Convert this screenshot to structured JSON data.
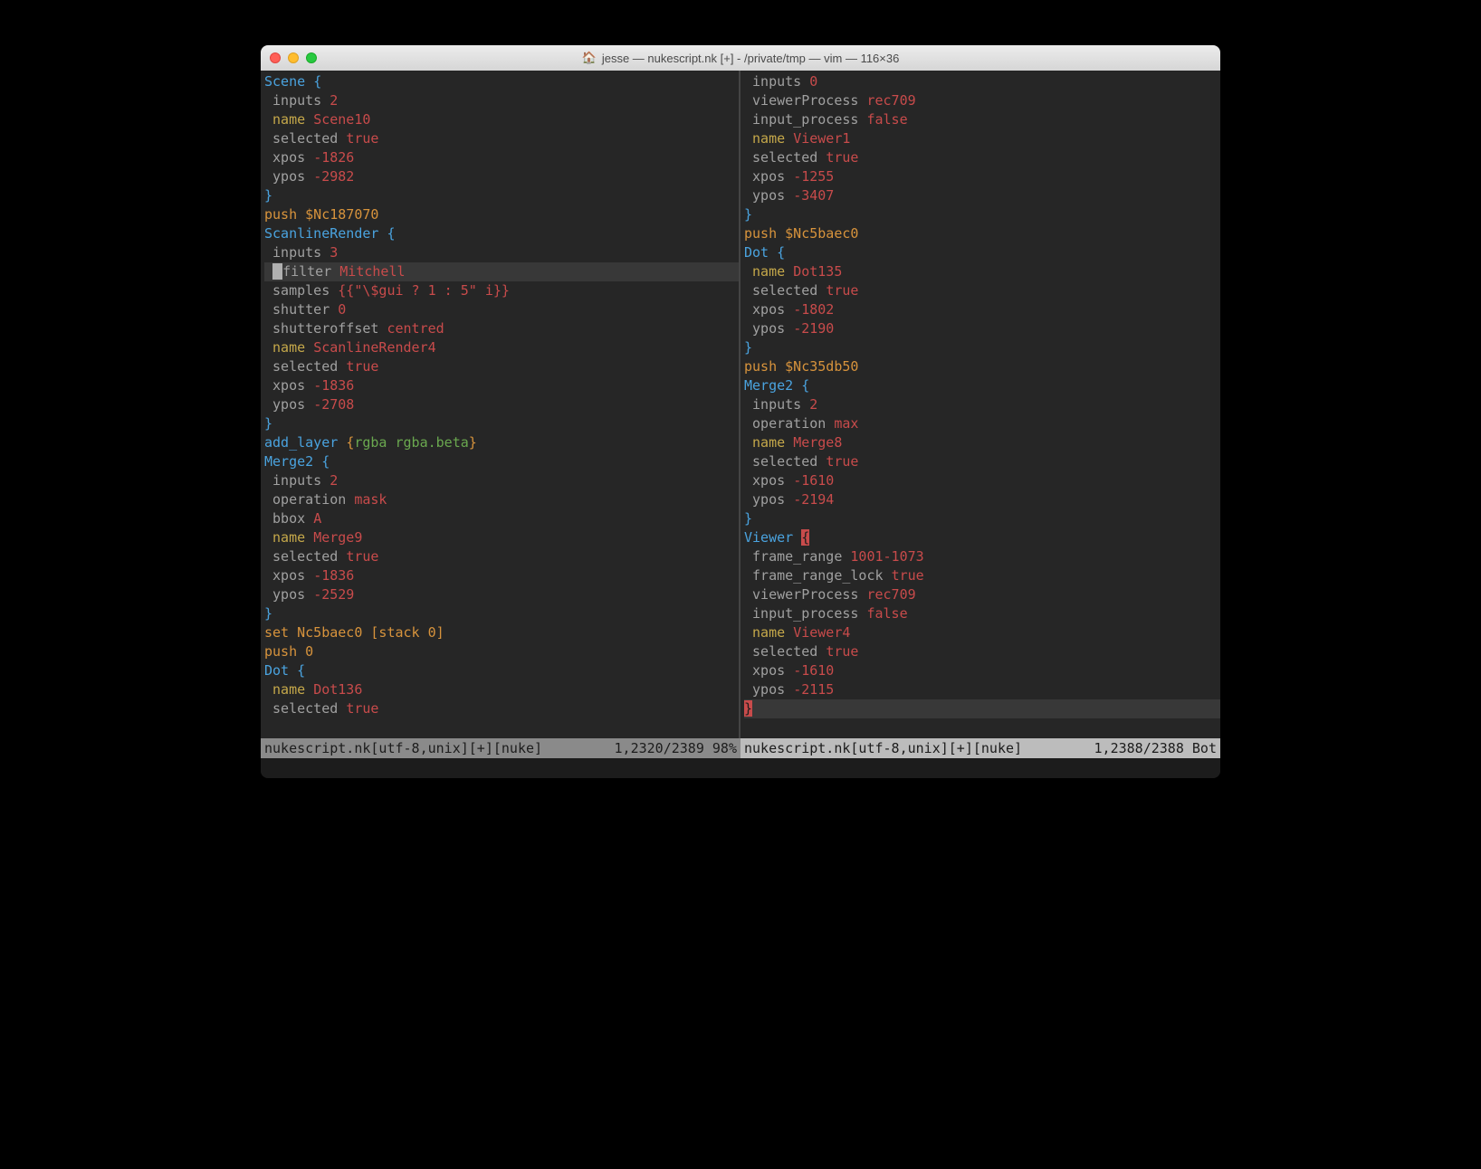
{
  "title": "jesse — nukescript.nk [+] - /private/tmp — vim — 116×36",
  "colors": {
    "bg": "#262626",
    "blue": "#4aa3df",
    "orange": "#d7933c",
    "yellow": "#c5a84a",
    "red": "#c84b4b",
    "green": "#6aa84f",
    "gray": "#a0a0a0",
    "status_inactive": "#8a8a8a",
    "status_active": "#bcbcbc",
    "cursorline": "#383838"
  },
  "left": {
    "status_left": "nukescript.nk[utf-8,unix][+][nuke]",
    "status_right": "1,2320/2389 98%",
    "lines": [
      [
        [
          "blue",
          "Scene"
        ],
        [
          "gray",
          " "
        ],
        [
          "blue",
          "{"
        ]
      ],
      [
        [
          "ind"
        ],
        [
          "gray",
          "inputs "
        ],
        [
          "red",
          "2"
        ]
      ],
      [
        [
          "ind"
        ],
        [
          "yellow",
          "name "
        ],
        [
          "red",
          "Scene10"
        ]
      ],
      [
        [
          "ind"
        ],
        [
          "gray",
          "selected "
        ],
        [
          "red",
          "true"
        ]
      ],
      [
        [
          "ind"
        ],
        [
          "gray",
          "xpos "
        ],
        [
          "red",
          "-1826"
        ]
      ],
      [
        [
          "ind"
        ],
        [
          "gray",
          "ypos "
        ],
        [
          "red",
          "-2982"
        ]
      ],
      [
        [
          "blue",
          "}"
        ]
      ],
      [
        [
          "orange",
          "push $Nc187070"
        ]
      ],
      [
        [
          "blue",
          "ScanlineRender"
        ],
        [
          "gray",
          " "
        ],
        [
          "blue",
          "{"
        ]
      ],
      [
        [
          "ind"
        ],
        [
          "gray",
          "inputs "
        ],
        [
          "red",
          "3"
        ]
      ],
      [
        [
          "cursorline"
        ],
        [
          "ind"
        ],
        [
          "cursorblock",
          " "
        ],
        [
          "gray",
          "filter "
        ],
        [
          "red",
          "Mitchell"
        ]
      ],
      [
        [
          "ind"
        ],
        [
          "gray",
          "samples "
        ],
        [
          "red",
          "{{\"\\$gui ? 1 : 5\" i}}"
        ]
      ],
      [
        [
          "ind"
        ],
        [
          "gray",
          "shutter "
        ],
        [
          "red",
          "0"
        ]
      ],
      [
        [
          "ind"
        ],
        [
          "gray",
          "shutteroffset "
        ],
        [
          "red",
          "centred"
        ]
      ],
      [
        [
          "ind"
        ],
        [
          "yellow",
          "name "
        ],
        [
          "red",
          "ScanlineRender4"
        ]
      ],
      [
        [
          "ind"
        ],
        [
          "gray",
          "selected "
        ],
        [
          "red",
          "true"
        ]
      ],
      [
        [
          "ind"
        ],
        [
          "gray",
          "xpos "
        ],
        [
          "red",
          "-1836"
        ]
      ],
      [
        [
          "ind"
        ],
        [
          "gray",
          "ypos "
        ],
        [
          "red",
          "-2708"
        ]
      ],
      [
        [
          "blue",
          "}"
        ]
      ],
      [
        [
          "blue",
          "add_layer "
        ],
        [
          "orange",
          "{"
        ],
        [
          "green",
          "rgba rgba.beta"
        ],
        [
          "orange",
          "}"
        ]
      ],
      [
        [
          "blue",
          "Merge2"
        ],
        [
          "gray",
          " "
        ],
        [
          "blue",
          "{"
        ]
      ],
      [
        [
          "ind"
        ],
        [
          "gray",
          "inputs "
        ],
        [
          "red",
          "2"
        ]
      ],
      [
        [
          "ind"
        ],
        [
          "gray",
          "operation "
        ],
        [
          "red",
          "mask"
        ]
      ],
      [
        [
          "ind"
        ],
        [
          "gray",
          "bbox "
        ],
        [
          "red",
          "A"
        ]
      ],
      [
        [
          "ind"
        ],
        [
          "yellow",
          "name "
        ],
        [
          "red",
          "Merge9"
        ]
      ],
      [
        [
          "ind"
        ],
        [
          "gray",
          "selected "
        ],
        [
          "red",
          "true"
        ]
      ],
      [
        [
          "ind"
        ],
        [
          "gray",
          "xpos "
        ],
        [
          "red",
          "-1836"
        ]
      ],
      [
        [
          "ind"
        ],
        [
          "gray",
          "ypos "
        ],
        [
          "red",
          "-2529"
        ]
      ],
      [
        [
          "blue",
          "}"
        ]
      ],
      [
        [
          "orange",
          "set Nc5baec0 [stack 0]"
        ]
      ],
      [
        [
          "orange",
          "push 0"
        ]
      ],
      [
        [
          "blue",
          "Dot"
        ],
        [
          "gray",
          " "
        ],
        [
          "blue",
          "{"
        ]
      ],
      [
        [
          "ind"
        ],
        [
          "yellow",
          "name "
        ],
        [
          "red",
          "Dot136"
        ]
      ],
      [
        [
          "ind"
        ],
        [
          "gray",
          "selected "
        ],
        [
          "red",
          "true"
        ]
      ]
    ]
  },
  "right": {
    "status_left": "nukescript.nk[utf-8,unix][+][nuke]",
    "status_right": "1,2388/2388 Bot",
    "lines": [
      [
        [
          "ind"
        ],
        [
          "gray",
          "inputs "
        ],
        [
          "red",
          "0"
        ]
      ],
      [
        [
          "ind"
        ],
        [
          "gray",
          "viewerProcess "
        ],
        [
          "red",
          "rec709"
        ]
      ],
      [
        [
          "ind"
        ],
        [
          "gray",
          "input_process "
        ],
        [
          "red",
          "false"
        ]
      ],
      [
        [
          "ind"
        ],
        [
          "yellow",
          "name "
        ],
        [
          "red",
          "Viewer1"
        ]
      ],
      [
        [
          "ind"
        ],
        [
          "gray",
          "selected "
        ],
        [
          "red",
          "true"
        ]
      ],
      [
        [
          "ind"
        ],
        [
          "gray",
          "xpos "
        ],
        [
          "red",
          "-1255"
        ]
      ],
      [
        [
          "ind"
        ],
        [
          "gray",
          "ypos "
        ],
        [
          "red",
          "-3407"
        ]
      ],
      [
        [
          "blue",
          "}"
        ]
      ],
      [
        [
          "orange",
          "push $Nc5baec0"
        ]
      ],
      [
        [
          "blue",
          "Dot"
        ],
        [
          "gray",
          " "
        ],
        [
          "blue",
          "{"
        ]
      ],
      [
        [
          "ind"
        ],
        [
          "yellow",
          "name "
        ],
        [
          "red",
          "Dot135"
        ]
      ],
      [
        [
          "ind"
        ],
        [
          "gray",
          "selected "
        ],
        [
          "red",
          "true"
        ]
      ],
      [
        [
          "ind"
        ],
        [
          "gray",
          "xpos "
        ],
        [
          "red",
          "-1802"
        ]
      ],
      [
        [
          "ind"
        ],
        [
          "gray",
          "ypos "
        ],
        [
          "red",
          "-2190"
        ]
      ],
      [
        [
          "blue",
          "}"
        ]
      ],
      [
        [
          "orange",
          "push $Nc35db50"
        ]
      ],
      [
        [
          "blue",
          "Merge2"
        ],
        [
          "gray",
          " "
        ],
        [
          "blue",
          "{"
        ]
      ],
      [
        [
          "ind"
        ],
        [
          "gray",
          "inputs "
        ],
        [
          "red",
          "2"
        ]
      ],
      [
        [
          "ind"
        ],
        [
          "gray",
          "operation "
        ],
        [
          "red",
          "max"
        ]
      ],
      [
        [
          "ind"
        ],
        [
          "yellow",
          "name "
        ],
        [
          "red",
          "Merge8"
        ]
      ],
      [
        [
          "ind"
        ],
        [
          "gray",
          "selected "
        ],
        [
          "red",
          "true"
        ]
      ],
      [
        [
          "ind"
        ],
        [
          "gray",
          "xpos "
        ],
        [
          "red",
          "-1610"
        ]
      ],
      [
        [
          "ind"
        ],
        [
          "gray",
          "ypos "
        ],
        [
          "red",
          "-2194"
        ]
      ],
      [
        [
          "blue",
          "}"
        ]
      ],
      [
        [
          "blue",
          "Viewer"
        ],
        [
          "gray",
          " "
        ],
        [
          "cursorredblock",
          "{"
        ]
      ],
      [
        [
          "ind"
        ],
        [
          "gray",
          "frame_range "
        ],
        [
          "red",
          "1001-1073"
        ]
      ],
      [
        [
          "ind"
        ],
        [
          "gray",
          "frame_range_lock "
        ],
        [
          "red",
          "true"
        ]
      ],
      [
        [
          "ind"
        ],
        [
          "gray",
          "viewerProcess "
        ],
        [
          "red",
          "rec709"
        ]
      ],
      [
        [
          "ind"
        ],
        [
          "gray",
          "input_process "
        ],
        [
          "red",
          "false"
        ]
      ],
      [
        [
          "ind"
        ],
        [
          "yellow",
          "name "
        ],
        [
          "red",
          "Viewer4"
        ]
      ],
      [
        [
          "ind"
        ],
        [
          "gray",
          "selected "
        ],
        [
          "red",
          "true"
        ]
      ],
      [
        [
          "ind"
        ],
        [
          "gray",
          "xpos "
        ],
        [
          "red",
          "-1610"
        ]
      ],
      [
        [
          "ind"
        ],
        [
          "gray",
          "ypos "
        ],
        [
          "red",
          "-2115"
        ]
      ],
      [
        [
          "cursorline"
        ],
        [
          "cursorredblock",
          "}"
        ]
      ]
    ]
  }
}
